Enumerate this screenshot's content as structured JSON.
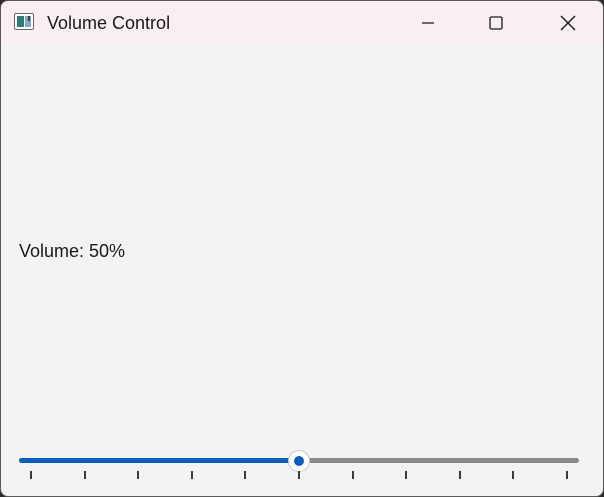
{
  "window": {
    "title": "Volume Control",
    "icon": "app-window-icon",
    "buttons": {
      "minimize": "minimize-icon",
      "maximize": "maximize-icon",
      "close": "close-icon"
    }
  },
  "volume": {
    "label": "Volume: 50%",
    "value": 50,
    "min": 0,
    "max": 100,
    "tick_count": 11
  },
  "colors": {
    "accent": "#0a5db8",
    "track": "#8a8a8a",
    "titlebar": "#f9eef0",
    "background": "#f3f3f3"
  }
}
